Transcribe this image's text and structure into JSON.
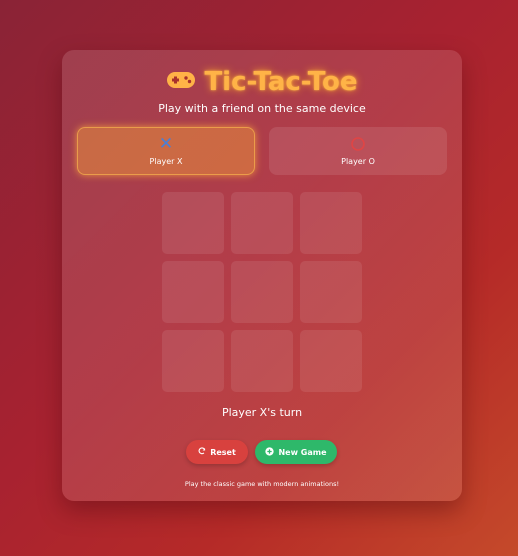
{
  "header": {
    "title": "Tic-Tac-Toe",
    "subtitle": "Play with a friend on the same device",
    "icon": "gamepad-icon"
  },
  "players": {
    "x": {
      "symbol": "✕",
      "label": "Player X",
      "active": true,
      "color": "#4a7fd6"
    },
    "o": {
      "symbol": "○",
      "label": "Player O",
      "active": false,
      "color": "#e04545"
    }
  },
  "board": {
    "cells": [
      "",
      "",
      "",
      "",
      "",
      "",
      "",
      "",
      ""
    ]
  },
  "status": {
    "text": "Player X's turn"
  },
  "controls": {
    "reset_label": "Reset",
    "reset_icon": "refresh-icon",
    "new_game_label": "New Game",
    "new_game_icon": "plus-circle-icon"
  },
  "footer": {
    "text": "Play the classic game with modern animations!"
  },
  "colors": {
    "accent": "#ffb347",
    "reset": "#d8413e",
    "new_game": "#2eb86a"
  }
}
